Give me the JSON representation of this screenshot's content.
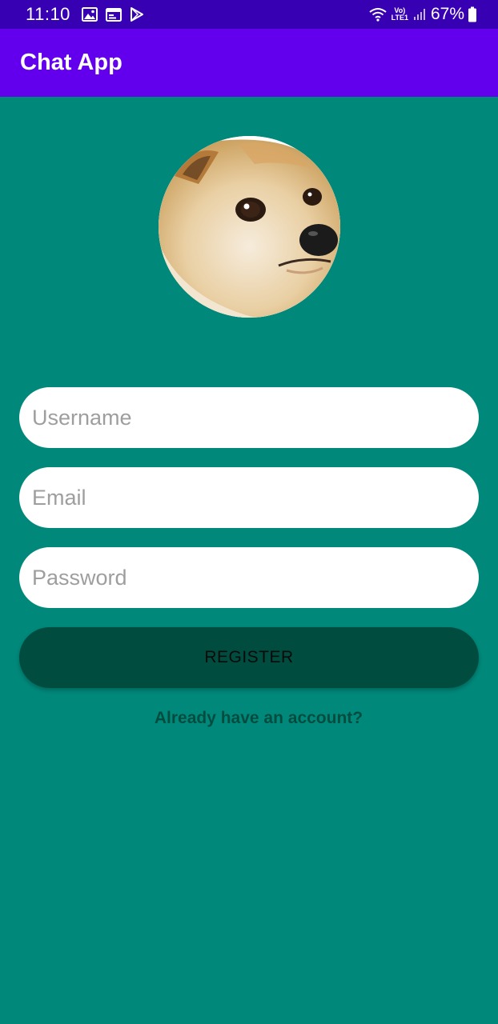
{
  "status_bar": {
    "time": "11:10",
    "battery": "67%",
    "icons": [
      "gallery-icon",
      "calendar-icon",
      "play-store-icon",
      "wifi-icon",
      "volte-lte-icon",
      "signal-icon",
      "battery-icon"
    ],
    "volte_top": "Vo)",
    "volte_bottom": "LTE1"
  },
  "app_bar": {
    "title": "Chat App"
  },
  "avatar": {
    "icon": "doge-avatar-image"
  },
  "form": {
    "username_placeholder": "Username",
    "email_placeholder": "Email",
    "password_placeholder": "Password",
    "register_label": "REGISTER",
    "login_link": "Already have an account?"
  },
  "colors": {
    "status_bar": "#3700b3",
    "app_bar": "#6200ee",
    "background": "#00897b",
    "button": "#004d40",
    "link": "#004d40"
  }
}
